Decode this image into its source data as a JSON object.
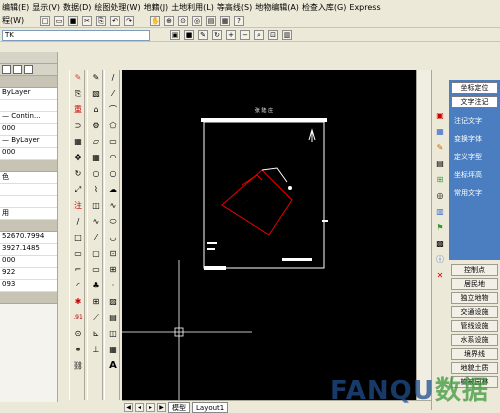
{
  "menu": [
    "编辑(E)",
    "显示(V)",
    "数据(D)",
    "绘图处理(W)",
    "地籍(J)",
    "土地利用(L)",
    "等高线(S)",
    "地物编辑(A)",
    "检查入库(G)",
    "Express"
  ],
  "menu_second_row": "程(W)",
  "layer_select_value": "TK",
  "left_panel": {
    "rows": [
      "ByLayer",
      "— Contin...",
      "000",
      "— ByLayer",
      "000",
      "色",
      "用",
      "52670.7994",
      "3927.1485",
      "000",
      "922",
      "093"
    ]
  },
  "drawing": {
    "title_text": "张 陆 庄"
  },
  "tabs": {
    "model": "模型",
    "layout": "Layout1"
  },
  "right_panel": {
    "buttons": [
      "坐标定位",
      "文字注记"
    ],
    "links": [
      "注记文字",
      "变换字体",
      "定义字型",
      "坐标坪高",
      "常用文字"
    ],
    "bottom_buttons": [
      "控制点",
      "居民地",
      "独立地物",
      "交通设施",
      "管线设施",
      "水系设施",
      "境界线",
      "地貌土质",
      "植被园林"
    ]
  },
  "watermark": {
    "main": "FANQU",
    "accent": "数据"
  }
}
